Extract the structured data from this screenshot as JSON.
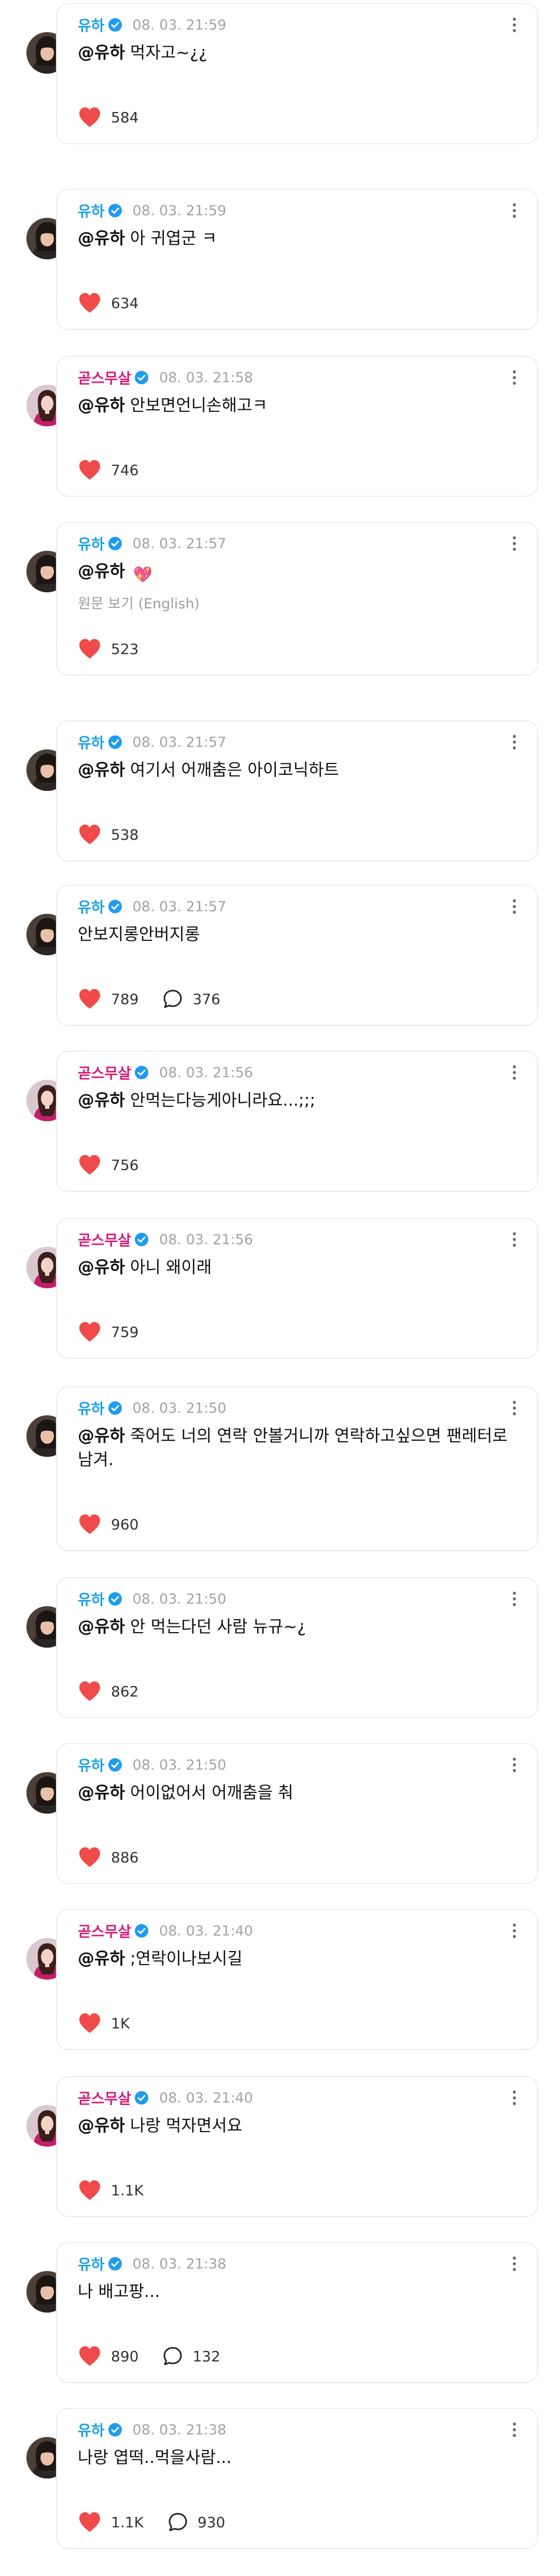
{
  "colors": {
    "heart": "#f04a4a",
    "verified": "#1f9bf0",
    "name_blue": "#1aa1e8",
    "name_pink": "#d61a78",
    "timestamp": "#a3a3a3"
  },
  "icons": {
    "like": "heart-icon",
    "reply": "speech-bubble-icon",
    "verified": "verified-badge-icon",
    "more": "vertical-ellipsis-icon"
  },
  "posts": [
    {
      "author": "유하",
      "author_color": "blue",
      "avatar": "dark",
      "time": "08. 03. 21:59",
      "mention": "@유하",
      "text": "먹자고~¿¿",
      "likes": "584"
    },
    {
      "author": "유하",
      "author_color": "blue",
      "avatar": "dark",
      "time": "08. 03. 21:59",
      "mention": "@유하",
      "text": "아 귀엽군 ㅋ",
      "likes": "634"
    },
    {
      "author": "곧스무살",
      "author_color": "pink",
      "avatar": "pink",
      "time": "08. 03. 21:58",
      "mention": "@유하",
      "text": "안보면언니손해고ㅋ",
      "likes": "746"
    },
    {
      "author": "유하",
      "author_color": "blue",
      "avatar": "dark",
      "time": "08. 03. 21:57",
      "mention": "@유하",
      "text": "",
      "emoji": "💖",
      "translate": "원문 보기 (English)",
      "likes": "523"
    },
    {
      "author": "유하",
      "author_color": "blue",
      "avatar": "dark",
      "time": "08. 03. 21:57",
      "mention": "@유하",
      "text": "여기서 어깨춤은 아이코닉하트",
      "likes": "538"
    },
    {
      "author": "유하",
      "author_color": "blue",
      "avatar": "dark",
      "time": "08. 03. 21:57",
      "mention": "",
      "text": "안보지롱안버지롱",
      "likes": "789",
      "replies": "376"
    },
    {
      "author": "곧스무살",
      "author_color": "pink",
      "avatar": "pink",
      "time": "08. 03. 21:56",
      "mention": "@유하",
      "text": "안먹는다능게아니라요...;;;",
      "likes": "756"
    },
    {
      "author": "곧스무살",
      "author_color": "pink",
      "avatar": "pink",
      "time": "08. 03. 21:56",
      "mention": "@유하",
      "text": "아니 왜이래",
      "likes": "759"
    },
    {
      "author": "유하",
      "author_color": "blue",
      "avatar": "dark",
      "time": "08. 03. 21:50",
      "mention": "@유하",
      "text": "죽어도 너의 연락 안볼거니까 연락하고싶으면 팬레터로 남겨.",
      "likes": "960"
    },
    {
      "author": "유하",
      "author_color": "blue",
      "avatar": "dark",
      "time": "08. 03. 21:50",
      "mention": "@유하",
      "text": "안 먹는다던 사람 뉴규~¿",
      "likes": "862"
    },
    {
      "author": "유하",
      "author_color": "blue",
      "avatar": "dark",
      "time": "08. 03. 21:50",
      "mention": "@유하",
      "text": "어이없어서 어깨춤을 춰",
      "likes": "886"
    },
    {
      "author": "곧스무살",
      "author_color": "pink",
      "avatar": "pink",
      "time": "08. 03. 21:40",
      "mention": "@유하",
      "text": ";연락이나보시길",
      "likes": "1K"
    },
    {
      "author": "곧스무살",
      "author_color": "pink",
      "avatar": "pink",
      "time": "08. 03. 21:40",
      "mention": "@유하",
      "text": "나랑 먹자면서요",
      "likes": "1.1K"
    },
    {
      "author": "유하",
      "author_color": "blue",
      "avatar": "dark",
      "time": "08. 03. 21:38",
      "mention": "",
      "text": "나 배고팡...",
      "likes": "890",
      "replies": "132"
    },
    {
      "author": "유하",
      "author_color": "blue",
      "avatar": "dark",
      "time": "08. 03. 21:38",
      "mention": "",
      "text": "나랑 엽떡..먹을사람...",
      "likes": "1.1K",
      "replies": "930"
    }
  ]
}
